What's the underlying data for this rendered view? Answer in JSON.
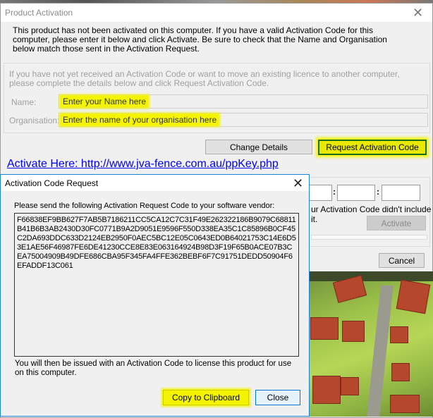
{
  "main_dialog": {
    "title": "Product Activation",
    "intro": "This product has not been activated on this computer.  If you have a valid Activation Code for this computer, please enter it below and click Activate.  Be sure to check that the Name and Organisation below match those sent in the Activation Request.",
    "request_info": "If you have not yet received an Activation Code or want to move an existing licence to another computer, please complete the details below and click Request Activation Code.",
    "name_label": "Name:",
    "name_value": "Enter your Name here",
    "org_label": "Organisation:",
    "org_value": "Enter the name of your organisation here",
    "change_details": "Change Details",
    "request_code": "Request Activation Code",
    "link": "Activate Here: http://www.jva-fence.com.au/ppKey.php",
    "code_separator": ":",
    "partial_hint": "ur Activation Code didn't include it.",
    "activate": "Activate",
    "cancel": "Cancel"
  },
  "request_dialog": {
    "title": "Activation Code Request",
    "instruction": "Please send the following Activation Request Code to your software vendor:",
    "code": "F66838EF9BB627F7AB5B7186211CC5CA12C7C31F49E262322186B9079C68811B41B6B3AB2430D30FC0771B9A2D9051E9596F550D338EA35C1C85896B0CF45C2DA693DDC633D2124EB2950F0AEC5BC12E05C0643ED0B64021753C14E6D53E1AE56F46987FE6DE41230CCE8E83E063164924B98D3F19F65B0ACE07B3CEA75004909B49DFE686CBA95F345FA4FFE362BEBF6F7C91751DEDD50904F6EFADDF13C061",
    "footer": "You will then be issued with an Activation Code to license this product for use on this computer.",
    "copy": "Copy to Clipboard",
    "close": "Close"
  },
  "colors": {
    "highlight": "#f4f400",
    "link": "#0000ff",
    "focus_border": "#1883d7"
  }
}
